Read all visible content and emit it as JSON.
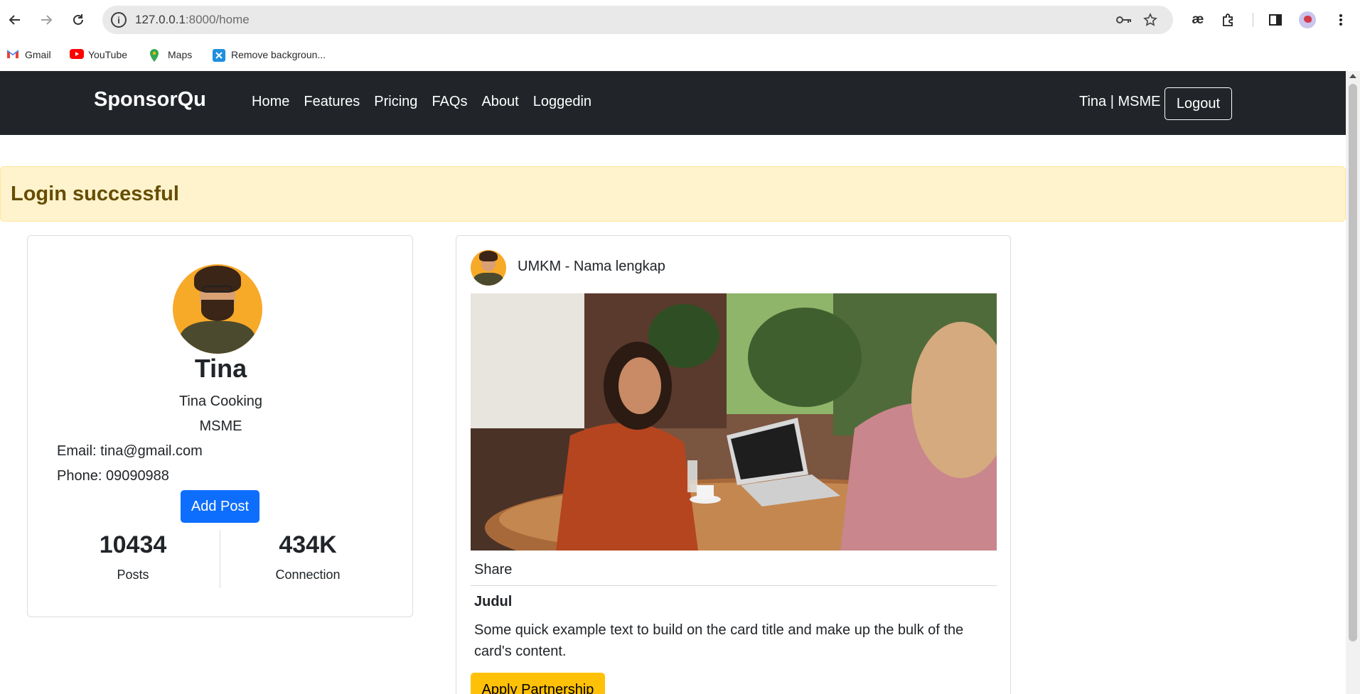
{
  "browser": {
    "url_host": "127.0.0.1",
    "url_path": ":8000/home",
    "bookmarks": [
      {
        "label": "Gmail",
        "icon": "gmail-icon"
      },
      {
        "label": "YouTube",
        "icon": "youtube-icon"
      },
      {
        "label": "Maps",
        "icon": "maps-icon"
      },
      {
        "label": "Remove backgroun...",
        "icon": "remove-bg-icon"
      }
    ],
    "extension_label": "æ"
  },
  "navbar": {
    "brand": "SponsorQu",
    "links": [
      "Home",
      "Features",
      "Pricing",
      "FAQs",
      "About",
      "Loggedin"
    ],
    "user_text": "Tina | MSME",
    "logout_label": "Logout"
  },
  "alert": {
    "text": "Login successful",
    "color": "#fff3cd"
  },
  "profile": {
    "name": "Tina",
    "business": "Tina Cooking",
    "role": "MSME",
    "email": "Email: tina@gmail.com",
    "phone": "Phone: 09090988",
    "add_post_label": "Add Post",
    "stats": [
      {
        "value": "10434",
        "label": "Posts"
      },
      {
        "value": "434K",
        "label": "Connection"
      }
    ]
  },
  "post": {
    "author": "UMKM - Nama lengkap",
    "share_label": "Share",
    "title": "Judul",
    "body": "Some quick example text to build on the card title and make up the bulk of the card's content.",
    "apply_label": "Apply Partnership"
  },
  "colors": {
    "navbar": "#212529",
    "primary": "#0d6efd",
    "warning": "#ffc107"
  }
}
